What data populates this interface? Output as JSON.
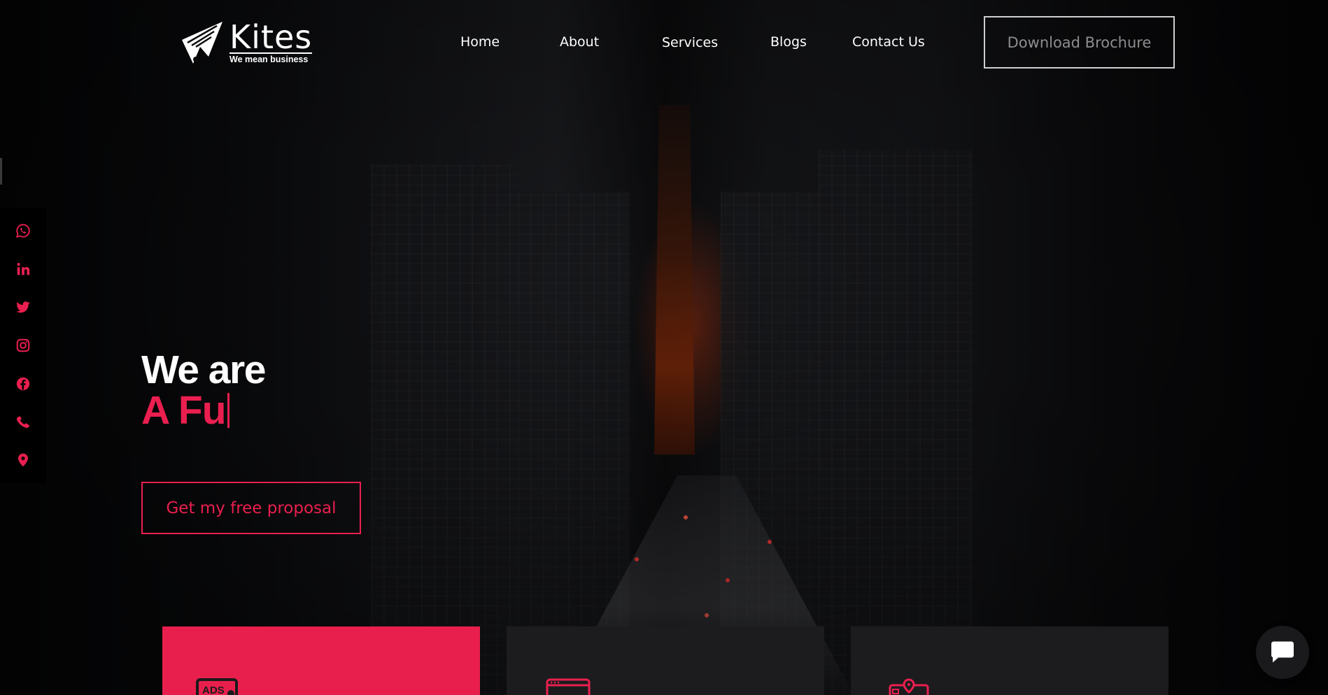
{
  "brand": {
    "name": "Kites",
    "tagline": "We mean business",
    "logo_icon": "paper-kite-logo-icon"
  },
  "nav": {
    "items": [
      {
        "label": "Home"
      },
      {
        "label": "About"
      },
      {
        "label": "Services"
      },
      {
        "label": "Blogs"
      },
      {
        "label": "Contact Us"
      }
    ],
    "cta_label": "Download Brochure"
  },
  "social": {
    "icons": [
      "whatsapp-icon",
      "linkedin-icon",
      "twitter-icon",
      "instagram-icon",
      "facebook-icon",
      "phone-icon",
      "location-pin-icon"
    ],
    "icon_color": "#ea1f4f"
  },
  "hero": {
    "heading": "We are",
    "typed_text": "A Fu",
    "cta_label": "Get my free proposal"
  },
  "cards": [
    {
      "icon": "ads-icon",
      "background": "#e81f4d"
    },
    {
      "icon": "browser-window-icon",
      "background": "#1c1c1e"
    },
    {
      "icon": "location-board-icon",
      "background": "#1c1c1e"
    }
  ],
  "chat": {
    "icon": "chat-bubble-icon"
  },
  "colors": {
    "accent": "#ea1f4f",
    "card_dark": "#1c1c1e",
    "text": "#ffffff"
  }
}
